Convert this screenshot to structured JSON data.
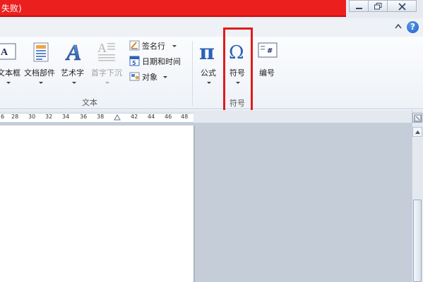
{
  "title_bar": {
    "title": "失败)"
  },
  "ribbon": {
    "text_group": {
      "label": "文本",
      "textbox_label": "文本框",
      "quickparts_label": "文档部件",
      "wordart_label": "艺术字",
      "dropcap_label": "首字下沉",
      "signature_label": "签名行",
      "datetime_label": "日期和时间",
      "object_label": "对象"
    },
    "equation_label": "公式",
    "symbol_label": "符号",
    "symbol_group_label": "符号",
    "number_label": "编号"
  },
  "ruler": {
    "ticks": [
      "6",
      "28",
      "30",
      "32",
      "34",
      "36",
      "38",
      "42",
      "44",
      "46",
      "48"
    ]
  },
  "colors": {
    "title_red": "#ec1f1f",
    "highlight": "#e01c1c",
    "pi_blue": "#2b62b8"
  }
}
